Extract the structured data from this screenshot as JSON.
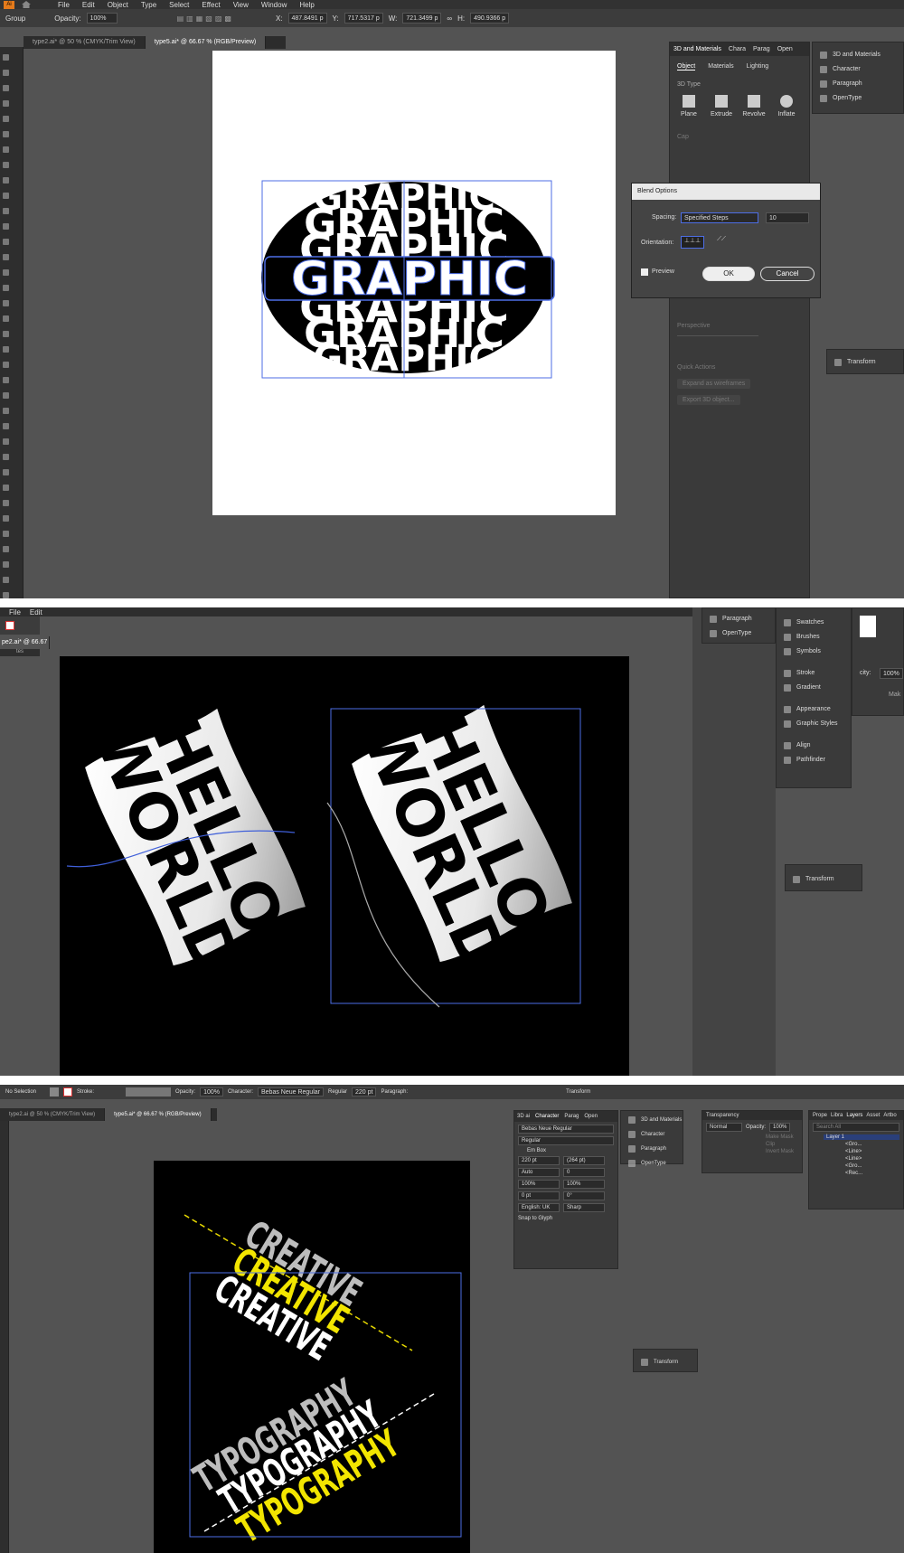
{
  "s1": {
    "menu": [
      "File",
      "Edit",
      "Object",
      "Type",
      "Select",
      "Effect",
      "View",
      "Window",
      "Help"
    ],
    "control": {
      "selection": "Group",
      "opacity_label": "Opacity:",
      "opacity": "100%",
      "x_label": "X:",
      "x": "487.8491 p",
      "y_label": "Y:",
      "y": "717.5317 p",
      "w_label": "W:",
      "w": "721.3499 p",
      "h_label": "H:",
      "h": "490.9366 p"
    },
    "tabs": [
      "type2.ai* @ 50 % (CMYK/Trim View)",
      "type5.ai* @ 66.67 % (RGB/Preview)"
    ],
    "artwork": {
      "word": "GRAPHIC",
      "echo": "GRAPHIC"
    },
    "panel3d": {
      "tabs": [
        "3D and Materials",
        "Chara",
        "Parag",
        "Open"
      ],
      "subtabs": [
        "Object",
        "Materials",
        "Lighting"
      ],
      "section": "3D Type",
      "types": [
        "Plane",
        "Extrude",
        "Revolve",
        "Inflate"
      ],
      "cap": "Cap",
      "perspective": "Perspective",
      "quick": "Quick Actions",
      "expand": "Expand as wireframes",
      "export": "Export 3D object..."
    },
    "dock": [
      "3D and Materials",
      "Character",
      "Paragraph",
      "OpenType"
    ],
    "blend": {
      "title": "Blend Options",
      "spacing_label": "Spacing:",
      "spacing_value": "Specified Steps",
      "steps": "10",
      "orientation_label": "Orientation:",
      "preview": "Preview",
      "ok": "OK",
      "cancel": "Cancel"
    },
    "transform": "Transform"
  },
  "s2": {
    "menu": [
      "File",
      "Edit"
    ],
    "tab": "pe2.ai* @ 66.67",
    "tab_sub": "tes",
    "artwork": {
      "line1": "HELLO",
      "line2": "WORLD"
    },
    "dock_top": [
      "Paragraph",
      "OpenType"
    ],
    "dock": [
      "Swatches",
      "Brushes",
      "Symbols",
      "Stroke",
      "Gradient",
      "Appearance",
      "Graphic Styles",
      "Align",
      "Pathfinder"
    ],
    "transform": "Transform",
    "opacity_label": "city:",
    "opacity": "100%",
    "make": "Mak"
  },
  "s3": {
    "control": {
      "mode": "No Selection",
      "stroke_label": "Stroke:",
      "opacity_label": "Opacity:",
      "opacity": "100%",
      "character_label": "Character:",
      "font": "Bebas Neue Regular",
      "style": "Regular",
      "size": "220 pt",
      "paragraph_label": "Paragraph:",
      "transform": "Transform"
    },
    "tabs": [
      "type2.ai @ 50 % (CMYK/Trim View)",
      "type5.ai* @ 66.67 % (RGB/Preview)"
    ],
    "artwork": {
      "w1": "CREATIVE",
      "w2": "TYPOGRAPHY"
    },
    "character": {
      "tabs": [
        "3D ai",
        "Character",
        "Parag",
        "Open"
      ],
      "font": "Bebas Neue Regular",
      "style": "Regular",
      "em": "Em Box",
      "size": "220 pt",
      "leading": "(264 pt)",
      "tracking": "Auto",
      "kern": "0",
      "vscale": "100%",
      "hscale": "100%",
      "baseline": "0 pt",
      "rotate": "0°",
      "lang": "English: UK",
      "aa": "Sharp",
      "snap": "Snap to Glyph"
    },
    "dock": [
      "3D and Materials",
      "Character",
      "Paragraph",
      "OpenType"
    ],
    "transparency": {
      "title": "Transparency",
      "mode": "Normal",
      "opacity_label": "Opacity:",
      "opacity": "100%",
      "make": "Make Mask",
      "clip": "Clip",
      "invert": "Invert Mask"
    },
    "layers": {
      "tabs": [
        "Prope",
        "Libra",
        "Layers",
        "Asset",
        "Artbo"
      ],
      "search": "Search All",
      "layer": "Layer 1",
      "items": [
        "<Gro...",
        "<Line>",
        "<Line>",
        "<Gro...",
        "<Rec..."
      ]
    },
    "transform": "Transform"
  }
}
